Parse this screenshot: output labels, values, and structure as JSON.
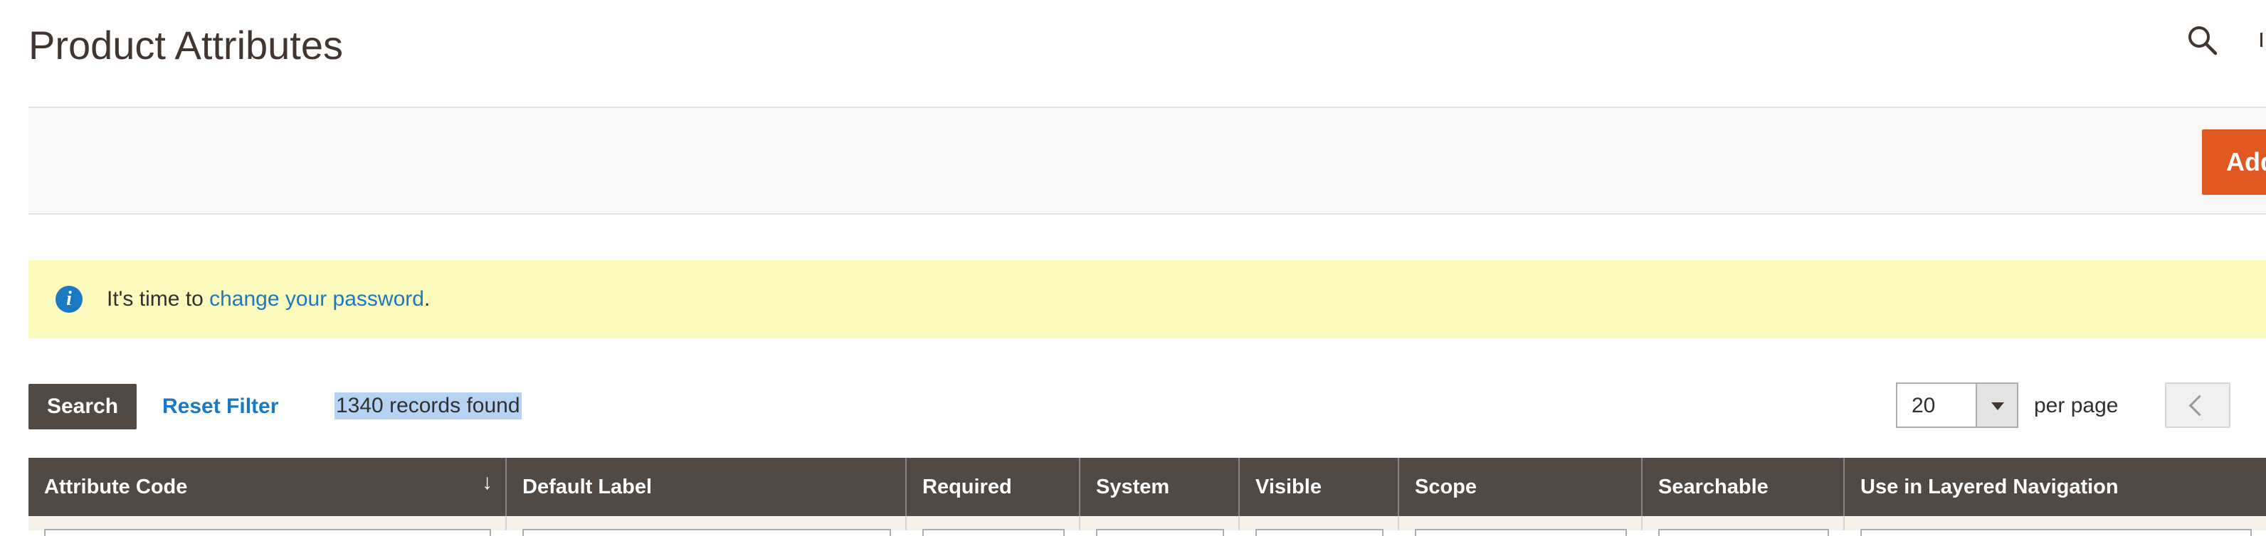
{
  "header": {
    "title": "Product Attributes",
    "search_icon": "search-icon"
  },
  "actions": {
    "add_button_label": "Add"
  },
  "notice": {
    "icon": "info-icon",
    "text_before": "It's time to ",
    "link_text": "change your password",
    "text_after": "."
  },
  "toolbar": {
    "search_label": "Search",
    "reset_label": "Reset Filter",
    "records_found": "1340 records found",
    "per_page_value": "20",
    "per_page_label": "per page",
    "prev_icon": "chevron-left-icon"
  },
  "grid": {
    "sort_indicator": "↓",
    "columns": [
      "Attribute Code",
      "Default Label",
      "Required",
      "System",
      "Visible",
      "Scope",
      "Searchable",
      "Use in Layered Navigation"
    ]
  },
  "colors": {
    "accent": "#e0571f",
    "link": "#1979c3",
    "header_bg": "#514943",
    "notice_bg": "#fdfabd",
    "selection": "#b6d3f4"
  }
}
